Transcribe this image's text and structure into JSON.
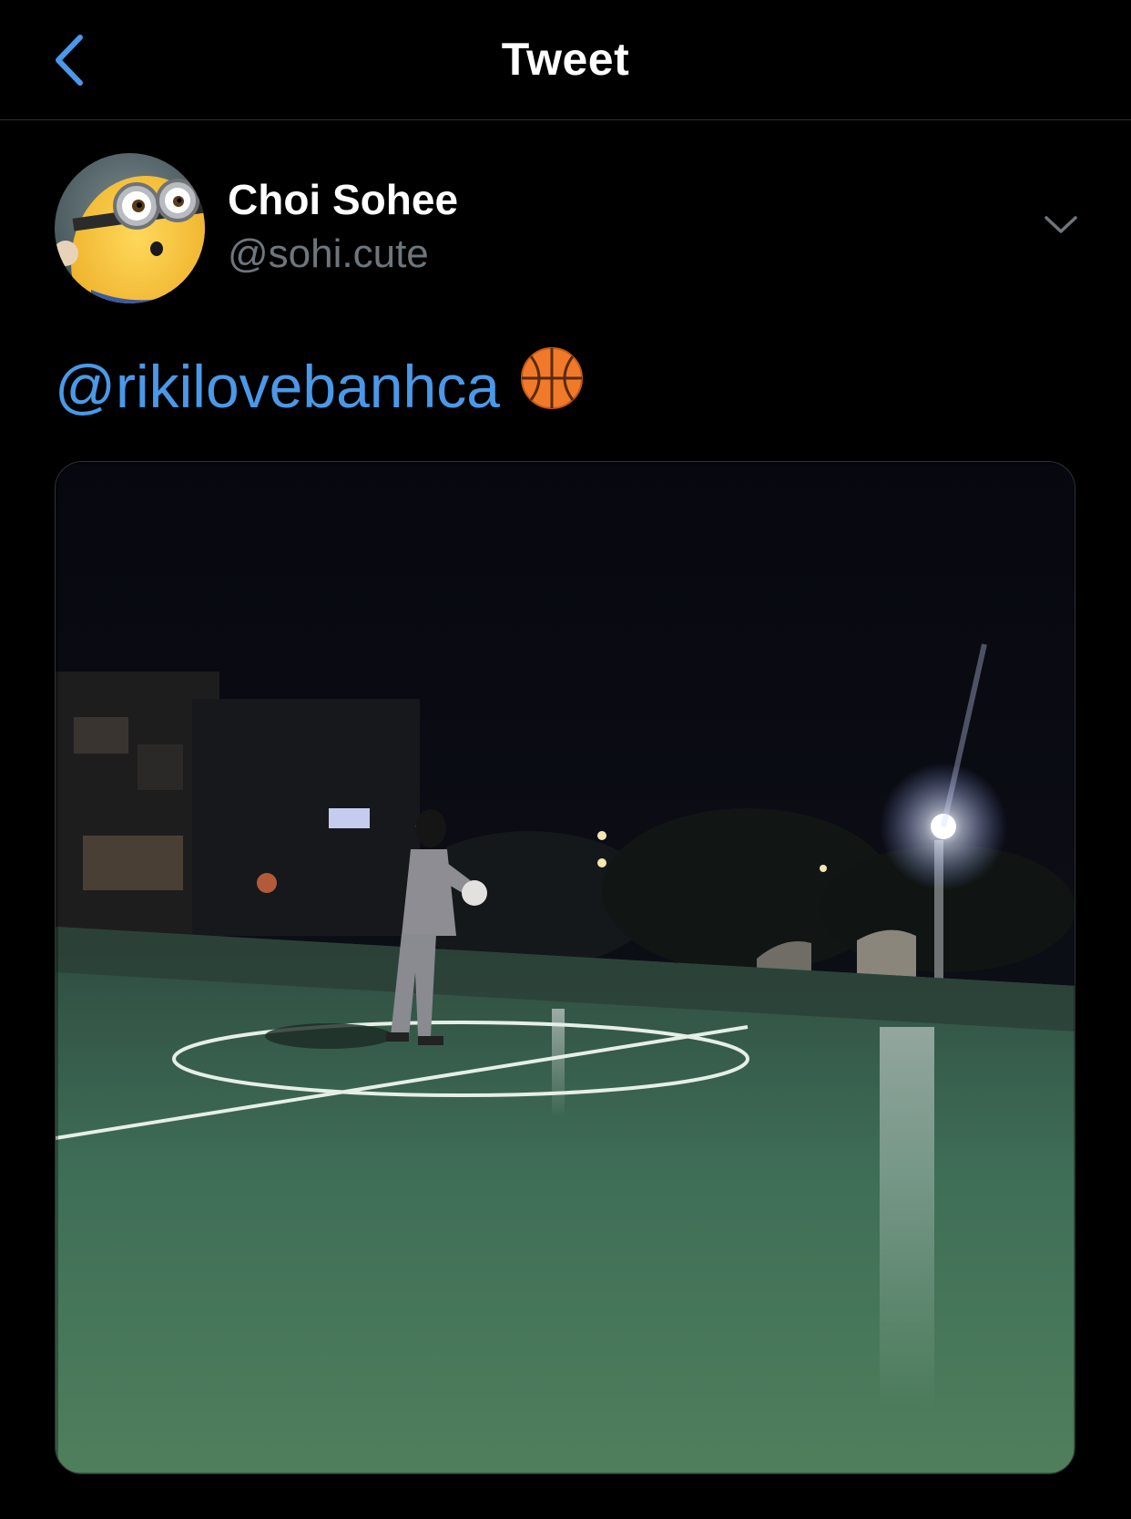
{
  "header": {
    "title": "Tweet",
    "back_icon": "chevron-left-icon",
    "accent_color": "#4a99e9"
  },
  "tweet": {
    "author": {
      "display_name": "Choi Sohee",
      "handle": "@sohi.cute",
      "avatar_icon": "minion-avatar"
    },
    "menu_icon": "chevron-down-icon",
    "text": {
      "mention": "@rikilovebanhca",
      "emoji_icon": "basketball-icon"
    },
    "media": {
      "type": "video",
      "subject": "night-basketball-court"
    }
  },
  "colors": {
    "background": "#000000",
    "link": "#4a99e9",
    "secondary_text": "#6e767d",
    "court": "#3f6e52"
  }
}
